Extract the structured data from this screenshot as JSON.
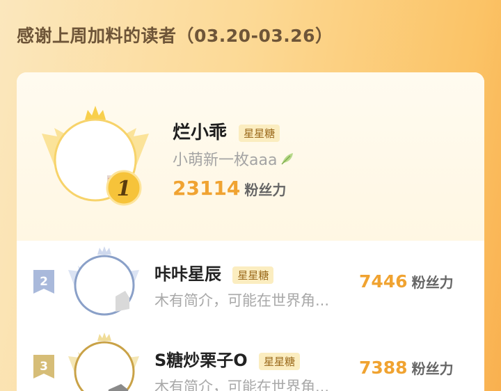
{
  "page_title": "感谢上周加料的读者（03.20-03.26）",
  "badge_label": "星星糖",
  "score_unit": "粉丝力",
  "top_reader": {
    "rank": "1",
    "name": "烂小乖",
    "bio": "小萌新一枚aaa",
    "score": "23114"
  },
  "readers": [
    {
      "rank": "2",
      "name": "咔咔星辰",
      "bio": "木有简介，可能在世界角...",
      "score": "7446"
    },
    {
      "rank": "3",
      "name": "S糖炒栗子O",
      "bio": "木有简介，可能在世界角...",
      "score": "7388"
    }
  ],
  "colors": {
    "gold": "#f0a331",
    "badge_bg": "#fbedc0",
    "silver": "#8aa0c8",
    "bronze": "#c9a247"
  }
}
